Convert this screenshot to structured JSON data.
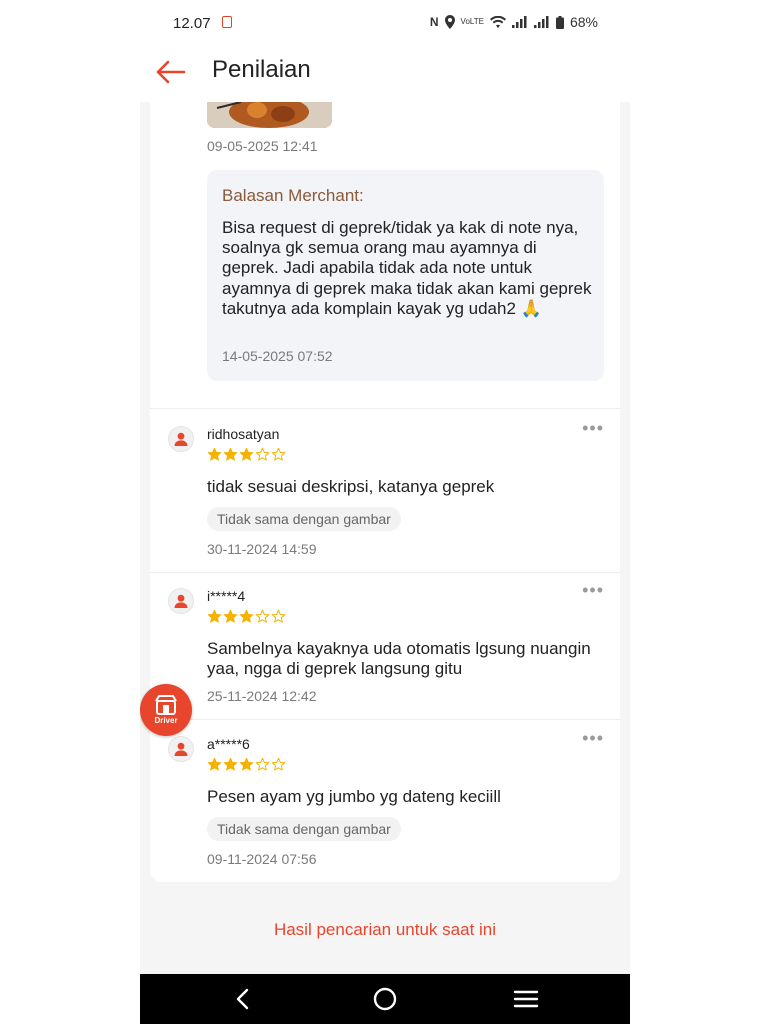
{
  "status_bar": {
    "time": "12.07",
    "battery": "68%"
  },
  "header": {
    "title": "Penilaian"
  },
  "top_review": {
    "timestamp": "09-05-2025 12:41",
    "merchant_reply": {
      "title": "Balasan Merchant:",
      "text": "Bisa request di geprek/tidak ya kak di note nya, soalnya gk semua orang mau ayamnya di geprek. Jadi apabila tidak ada note untuk ayamnya di geprek maka tidak akan kami geprek takutnya ada komplain kayak yg udah2 🙏",
      "timestamp": "14-05-2025 07:52"
    }
  },
  "reviews": [
    {
      "username": "ridhosatyan",
      "rating": 3,
      "text": "tidak sesuai deskripsi, katanya geprek",
      "tag": "Tidak sama dengan gambar",
      "timestamp": "30-11-2024 14:59"
    },
    {
      "username": "i*****4",
      "rating": 3,
      "text": "Sambelnya kayaknya uda otomatis lgsung nuangin yaa, ngga di geprek langsung gitu",
      "timestamp": "25-11-2024 12:42"
    },
    {
      "username": "a*****6",
      "rating": 3,
      "text": "Pesen ayam yg jumbo yg dateng keciill",
      "tag": "Tidak sama dengan gambar",
      "timestamp": "09-11-2024 07:56"
    }
  ],
  "floating_button": {
    "label": "Driver",
    "icon": "store-icon"
  },
  "footer": {
    "link_text": "Hasil pencarian untuk saat ini"
  },
  "navigation": {
    "icons": [
      "back-nav-icon",
      "home-nav-icon",
      "recents-nav-icon"
    ]
  },
  "colors": {
    "accent": "#e8452d",
    "star": "#f5b301",
    "reply_title": "#8a5a3c",
    "reply_bg": "#f2f4f7",
    "page_bg": "#f5f5f5"
  }
}
